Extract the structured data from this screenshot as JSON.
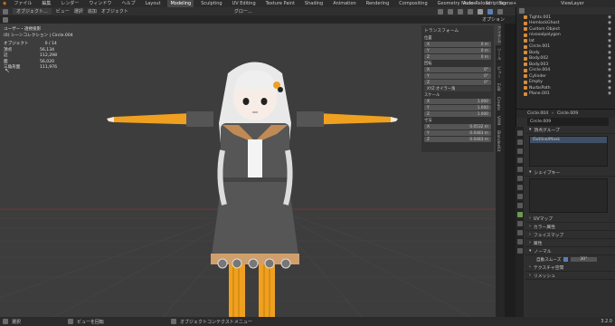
{
  "topbar": {
    "menus": [
      "ファイル",
      "編集",
      "レンダー",
      "ウィンドウ",
      "ヘルプ"
    ],
    "workspaces": [
      "Layout",
      "Modeling",
      "Sculpting",
      "UV Editing",
      "Texture Paint",
      "Shading",
      "Animation",
      "Rendering",
      "Compositing",
      "Geometry Nodes",
      "Scripting"
    ],
    "active_workspace": "Modeling",
    "autoreload": "Auto-Reload",
    "scene": "Scene",
    "viewlayer": "ViewLayer"
  },
  "header": {
    "mode": "オブジェクト...",
    "menus": [
      "ビュー",
      "選択",
      "追加",
      "オブジェクト"
    ],
    "orientation": "グロー...",
    "options": "オプション"
  },
  "overlay": {
    "view": "ユーザー・透視投影",
    "collection": "(0) シーンコレクション | Circle.004",
    "object_label": "オブジェクト",
    "object_value": "0 / 14",
    "vert_label": "頂点",
    "vert_value": "56,134",
    "edge_label": "辺",
    "edge_value": "112,298",
    "face_label": "面",
    "face_value": "56,020",
    "tri_label": "三角形面",
    "tri_value": "111,976"
  },
  "npanel": {
    "title": "トランスフォーム",
    "loc_label": "位置",
    "loc": [
      "0 m",
      "0 m",
      "0 m"
    ],
    "rot_label": "回転",
    "rot": [
      "0°",
      "0°",
      "0°"
    ],
    "rot_mode": "XYZ オイラー角",
    "scale_label": "スケール",
    "scale": [
      "1.000",
      "1.000",
      "1.000"
    ],
    "dim_label": "寸法",
    "dim": [
      "0.0532 m",
      "0.0483 m",
      "0.0483 m"
    ],
    "axes": [
      "X",
      "Y",
      "Z",
      "W"
    ],
    "tabs": [
      "アイテム",
      "ツール",
      "ビュー",
      "Edit",
      "Create",
      "VRM",
      "BlenderKit"
    ]
  },
  "outliner": {
    "items": [
      "Tights.001",
      "HemlockGhost",
      "Custom Object",
      "nivoxalpolygon",
      "lat",
      "Circle.001",
      "Body",
      "Body.002",
      "Body.003",
      "Circle.004",
      "Cylinder",
      "Empty",
      "NurbsPath",
      "Plane.001"
    ]
  },
  "props": {
    "object": "Circle.004",
    "mesh": "Circle.009",
    "mesh_name": "Circle.009",
    "vgroups": "頂点グループ",
    "vgroup_item": "Outline/Mask",
    "shapekeys": "シェイプキー",
    "sections": [
      "UVマップ",
      "カラー属性",
      "フェイスマップ",
      "属性",
      "ノーマル"
    ],
    "autosmooth": "自動スムーズ",
    "autosmooth_val": "30°",
    "sections2": [
      "テクスチャ空間",
      "リメッシュ"
    ]
  },
  "status": {
    "select": "選択",
    "view_rotate": "ビューを回転",
    "context": "オブジェクトコンテクストメニュー",
    "version": "3.2.0"
  }
}
